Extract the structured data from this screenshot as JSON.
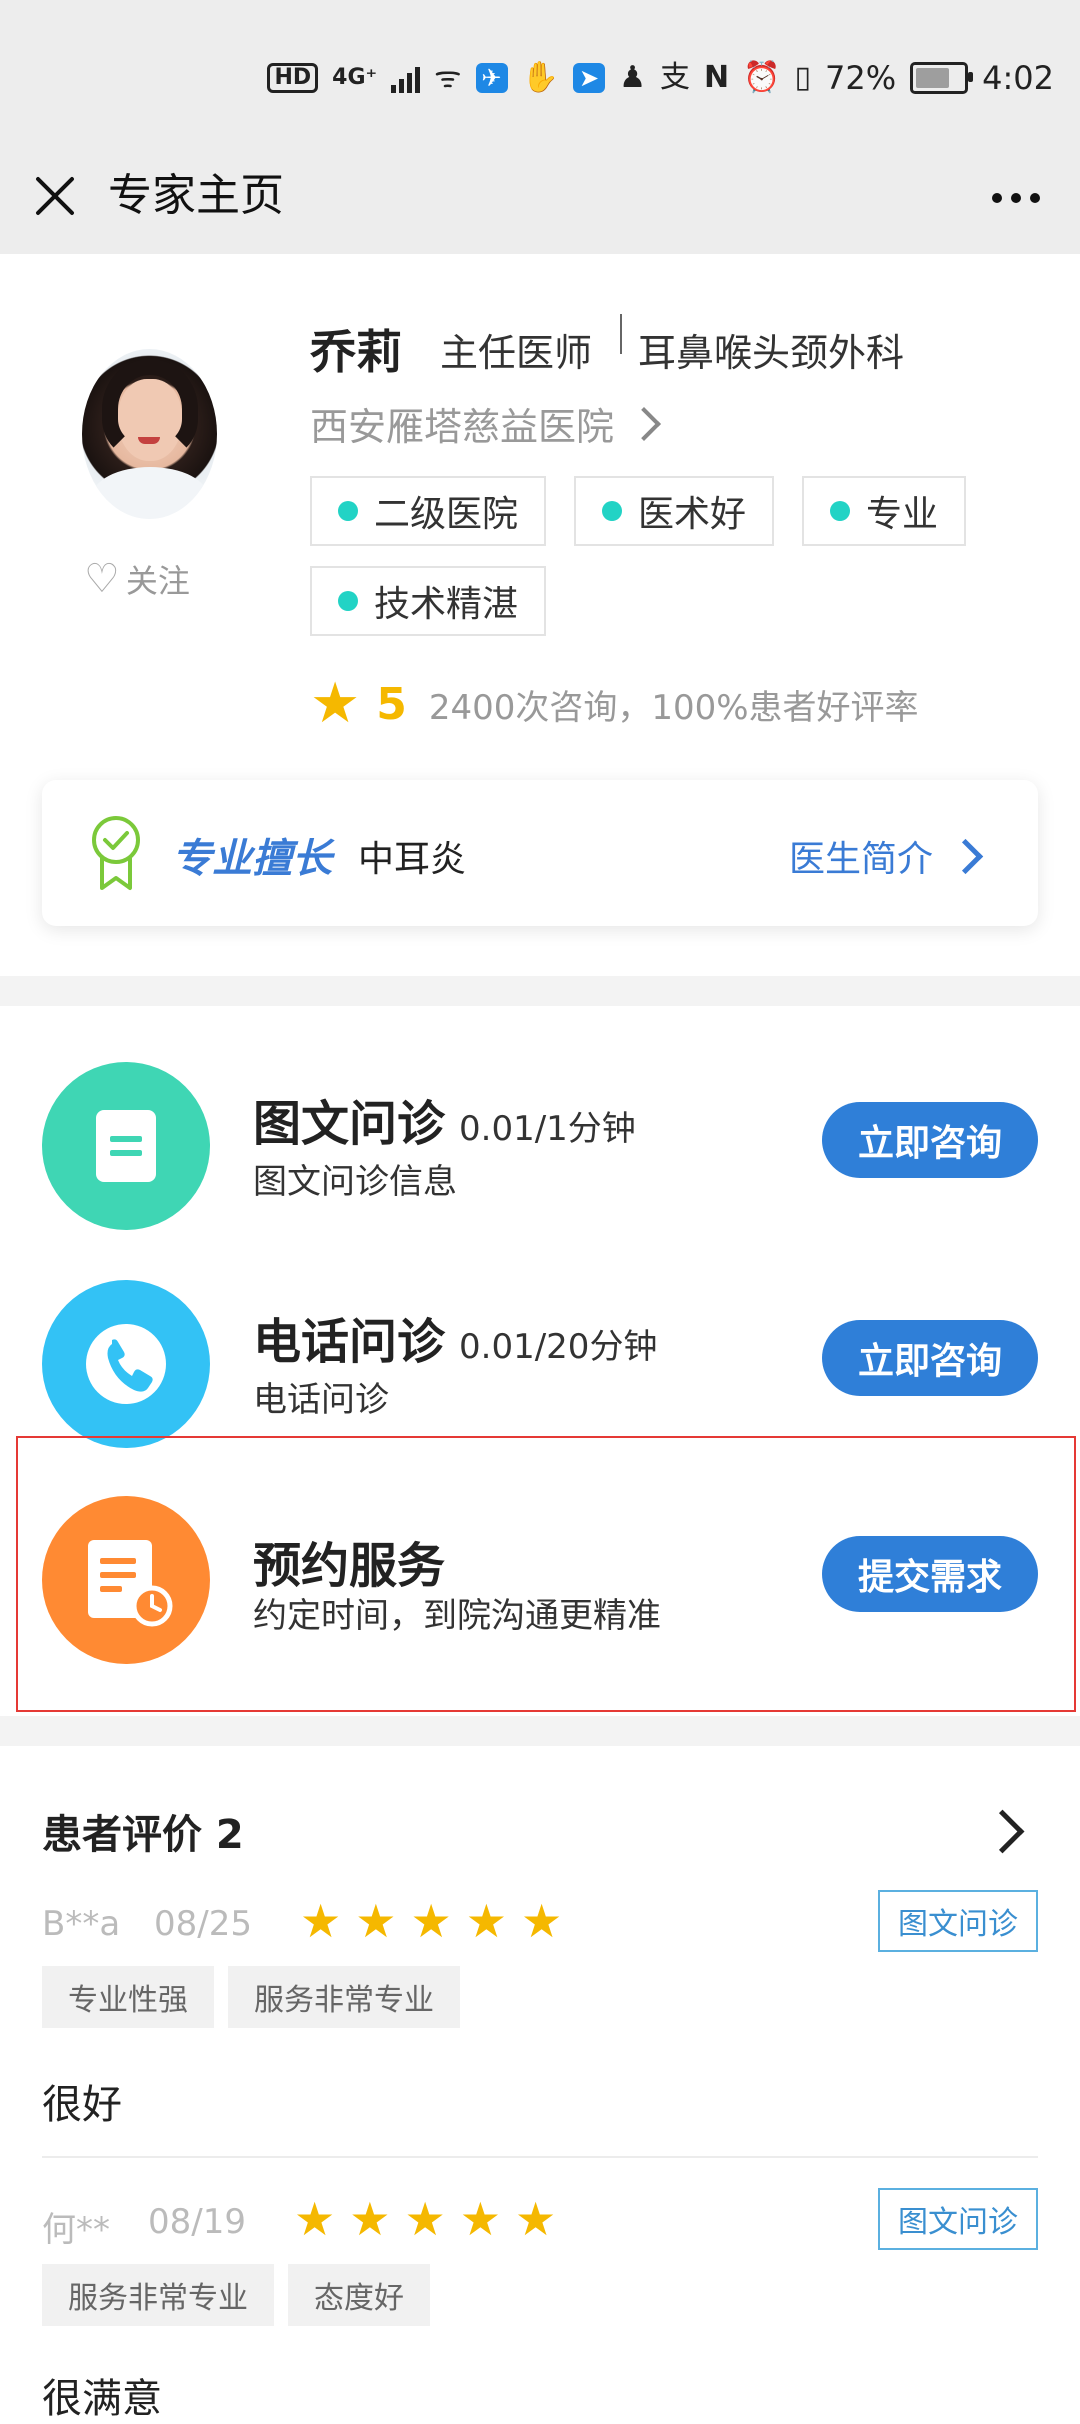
{
  "status_bar": {
    "network_badge": "HD",
    "network_type": "4G⁺",
    "battery_percent": "72%",
    "battery_level": 0.72,
    "time": "4:02"
  },
  "titlebar": {
    "title": "专家主页"
  },
  "doctor": {
    "name": "乔莉",
    "title": "主任医师",
    "department": "耳鼻喉头颈外科",
    "hospital": "西安雁塔慈益医院",
    "follow_label": "关注",
    "tags": [
      "二级医院",
      "医术好",
      "专业",
      "技术精湛"
    ],
    "rating_score": "5",
    "rating_meta": "2400次咨询，100%患者好评率",
    "specialty_label": "专业擅长",
    "specialty_value": "中耳炎",
    "intro_link": "医生简介"
  },
  "services": [
    {
      "title": "图文问诊",
      "price": "0.01/1分钟",
      "desc": "图文问诊信息",
      "button": "立即咨询",
      "color": "#3fd6b4",
      "icon": "document-icon"
    },
    {
      "title": "电话问诊",
      "price": "0.01/20分钟",
      "desc": "电话问诊",
      "button": "立即咨询",
      "color": "#33c2f5",
      "icon": "phone-icon"
    },
    {
      "title": "预约服务",
      "price": "",
      "desc": "约定时间，到院沟通更精准",
      "button": "提交需求",
      "color": "#ff8a33",
      "icon": "appointment-icon"
    }
  ],
  "reviews": {
    "title": "患者评价 2",
    "items": [
      {
        "user": "B**a",
        "date": "08/25",
        "stars": 5,
        "type": "图文问诊",
        "tags": [
          "专业性强",
          "服务非常专业"
        ],
        "content": "很好"
      },
      {
        "user": "何**",
        "date": "08/19",
        "stars": 5,
        "type": "图文问诊",
        "tags": [
          "服务非常专业",
          "态度好"
        ],
        "content": "很满意"
      }
    ]
  },
  "colors": {
    "accent_blue": "#2f7fd8",
    "star_yellow": "#f5b800",
    "tag_dot": "#22d3c5"
  }
}
